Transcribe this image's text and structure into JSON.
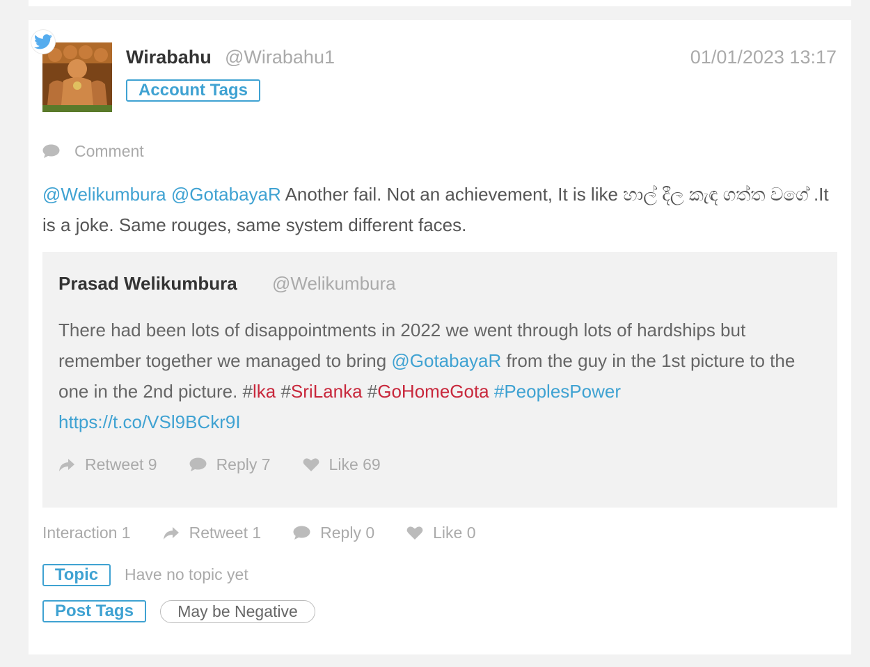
{
  "post": {
    "author_name": "Wirabahu",
    "author_handle": "@Wirabahu1",
    "timestamp": "01/01/2023 13:17",
    "account_tags_label": "Account Tags",
    "type_label": "Comment",
    "platform_icon": "twitter-icon",
    "text": {
      "mention1": "@Welikumbura",
      "mention2": "@GotabayaR",
      "body": " Another fail. Not an achievement, It is like හාල් දීල කැඳ ගත්ත වගේ .It is a joke. Same rouges, same system different faces."
    }
  },
  "quoted": {
    "author_name": "Prasad Welikumbura",
    "author_handle": "@Welikumbura",
    "text": {
      "part1": "There had been lots of disappointments in 2022 we went through lots of hardships but remember together we managed to bring ",
      "mention": "@GotabayaR",
      "part2": " from the guy in the 1st picture to the one in the 2nd picture. #",
      "tag1": "lka",
      "sep1": " #",
      "tag2": "SriLanka",
      "sep2": " #",
      "tag3": "GoHomeGota",
      "sep3": " ",
      "tag4": "#PeoplesPower",
      "link": "https://t.co/VSl9BCkr9I"
    },
    "stats": {
      "retweet": "Retweet 9",
      "reply": "Reply 7",
      "like": "Like 69"
    }
  },
  "stats": {
    "interaction": "Interaction 1",
    "retweet": "Retweet 1",
    "reply": "Reply 0",
    "like": "Like 0"
  },
  "topic": {
    "label": "Topic",
    "empty_text": "Have no topic yet"
  },
  "post_tags": {
    "label": "Post Tags",
    "tags": [
      "May be Negative"
    ]
  },
  "colors": {
    "accent": "#3fa2d2",
    "hashtag_red": "#c8283c",
    "muted": "#aaaaaa"
  }
}
